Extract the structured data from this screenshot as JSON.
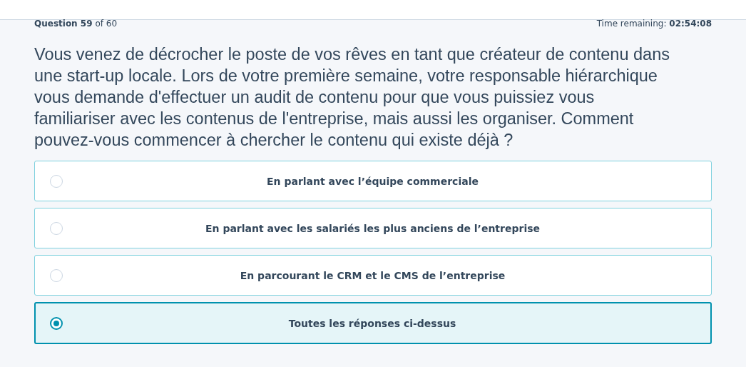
{
  "progress": {
    "label": "Question",
    "current": "59",
    "of": "of 60"
  },
  "timer": {
    "label": "Time remaining:",
    "value": "02:54:08"
  },
  "question": "Vous venez de décrocher le poste de vos rêves en tant que créateur de contenu dans une start-up locale. Lors de votre première semaine, votre responsable hiérarchique vous demande d'effectuer un audit de contenu pour que vous puissiez vous familiariser avec les contenus de l'entreprise, mais aussi les organiser. Comment pouvez-vous commencer à chercher le contenu qui existe déjà ?",
  "answers": [
    {
      "label": "En parlant avec l’équipe commerciale",
      "selected": false
    },
    {
      "label": "En parlant avec les salariés les plus anciens de l’entreprise",
      "selected": false
    },
    {
      "label": "En parcourant le CRM et le CMS de l’entreprise",
      "selected": false
    },
    {
      "label": "Toutes les réponses ci-dessus",
      "selected": true
    }
  ]
}
